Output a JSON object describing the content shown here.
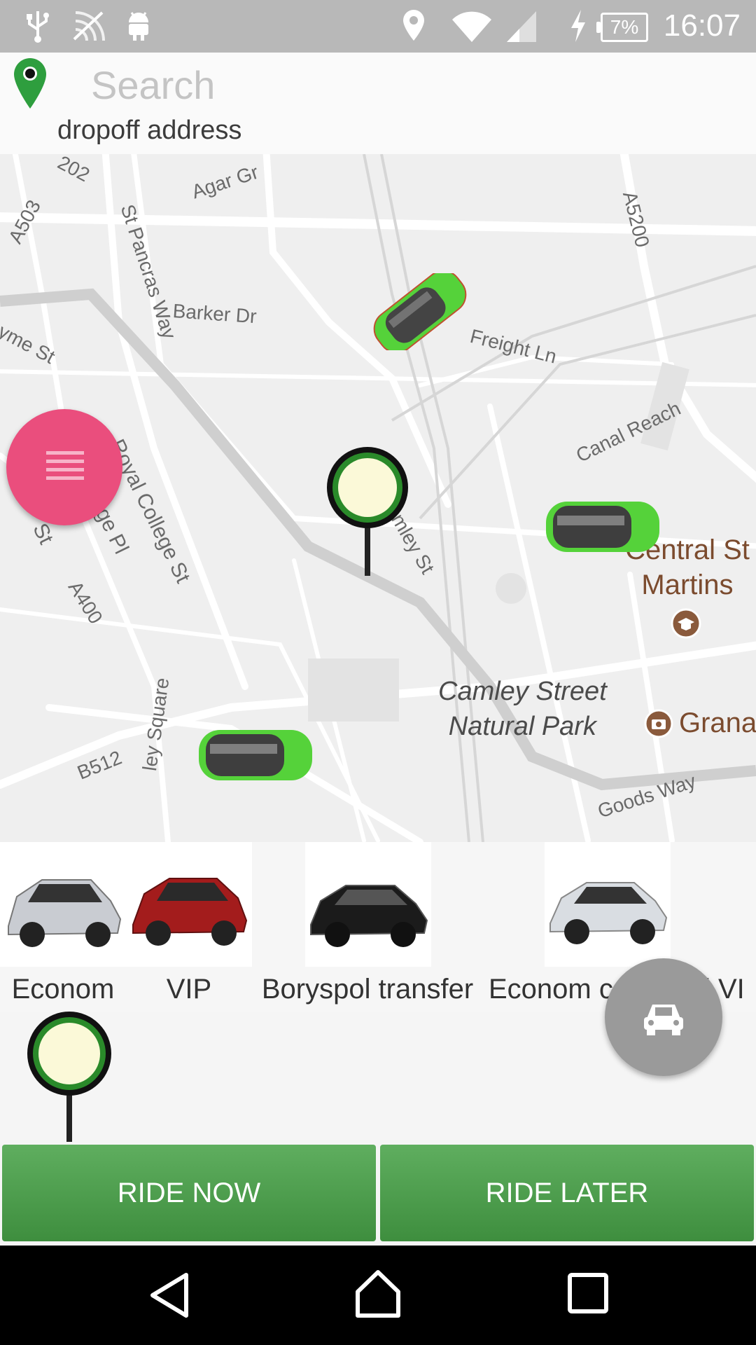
{
  "status_bar": {
    "time": "16:07",
    "battery": "7%",
    "icons": [
      "usb-icon",
      "nfc-icon",
      "android-icon",
      "location-icon",
      "wifi-icon",
      "signal-icon",
      "charging-icon",
      "battery-icon"
    ]
  },
  "header": {
    "search_placeholder": "Search",
    "dropoff_label": "dropoff address",
    "pin_color": "#2e9e3e"
  },
  "map": {
    "street_labels": [
      "202",
      "Agar Gr",
      "A503",
      "St Pancras Way",
      "Barker Dr",
      "Lyme St",
      "Royal College St",
      "ge Pl",
      "St",
      "A400",
      "Freight Ln",
      "Canal Reach",
      "A5200",
      "mley St",
      "B512",
      "ley Square",
      "Goods Way"
    ],
    "pois": {
      "central_st_martins": "Central St\nMartins",
      "camley_park": "Camley Street\nNatural Park",
      "granary": "Grana"
    },
    "car_color": "#55d23a"
  },
  "car_types": [
    {
      "name": "Econom",
      "car_color": "#c9ccd2"
    },
    {
      "name": "VIP",
      "car_color": "#a31c1c"
    },
    {
      "name": "Boryspol transfer",
      "car_color": "#1b1b1b"
    },
    {
      "name": "Econom c",
      "car_color": "#d9dde2"
    },
    {
      "name": "l VI",
      "car_color": "#cccccc"
    }
  ],
  "buttons": {
    "ride_now": "RIDE NOW",
    "ride_later": "RIDE LATER"
  },
  "nav": [
    "back-icon",
    "home-icon",
    "recents-icon"
  ],
  "colors": {
    "accent_green": "#4caf50",
    "menu_fab": "#ea4e7d",
    "taxi_fab": "#9a9a9a"
  }
}
